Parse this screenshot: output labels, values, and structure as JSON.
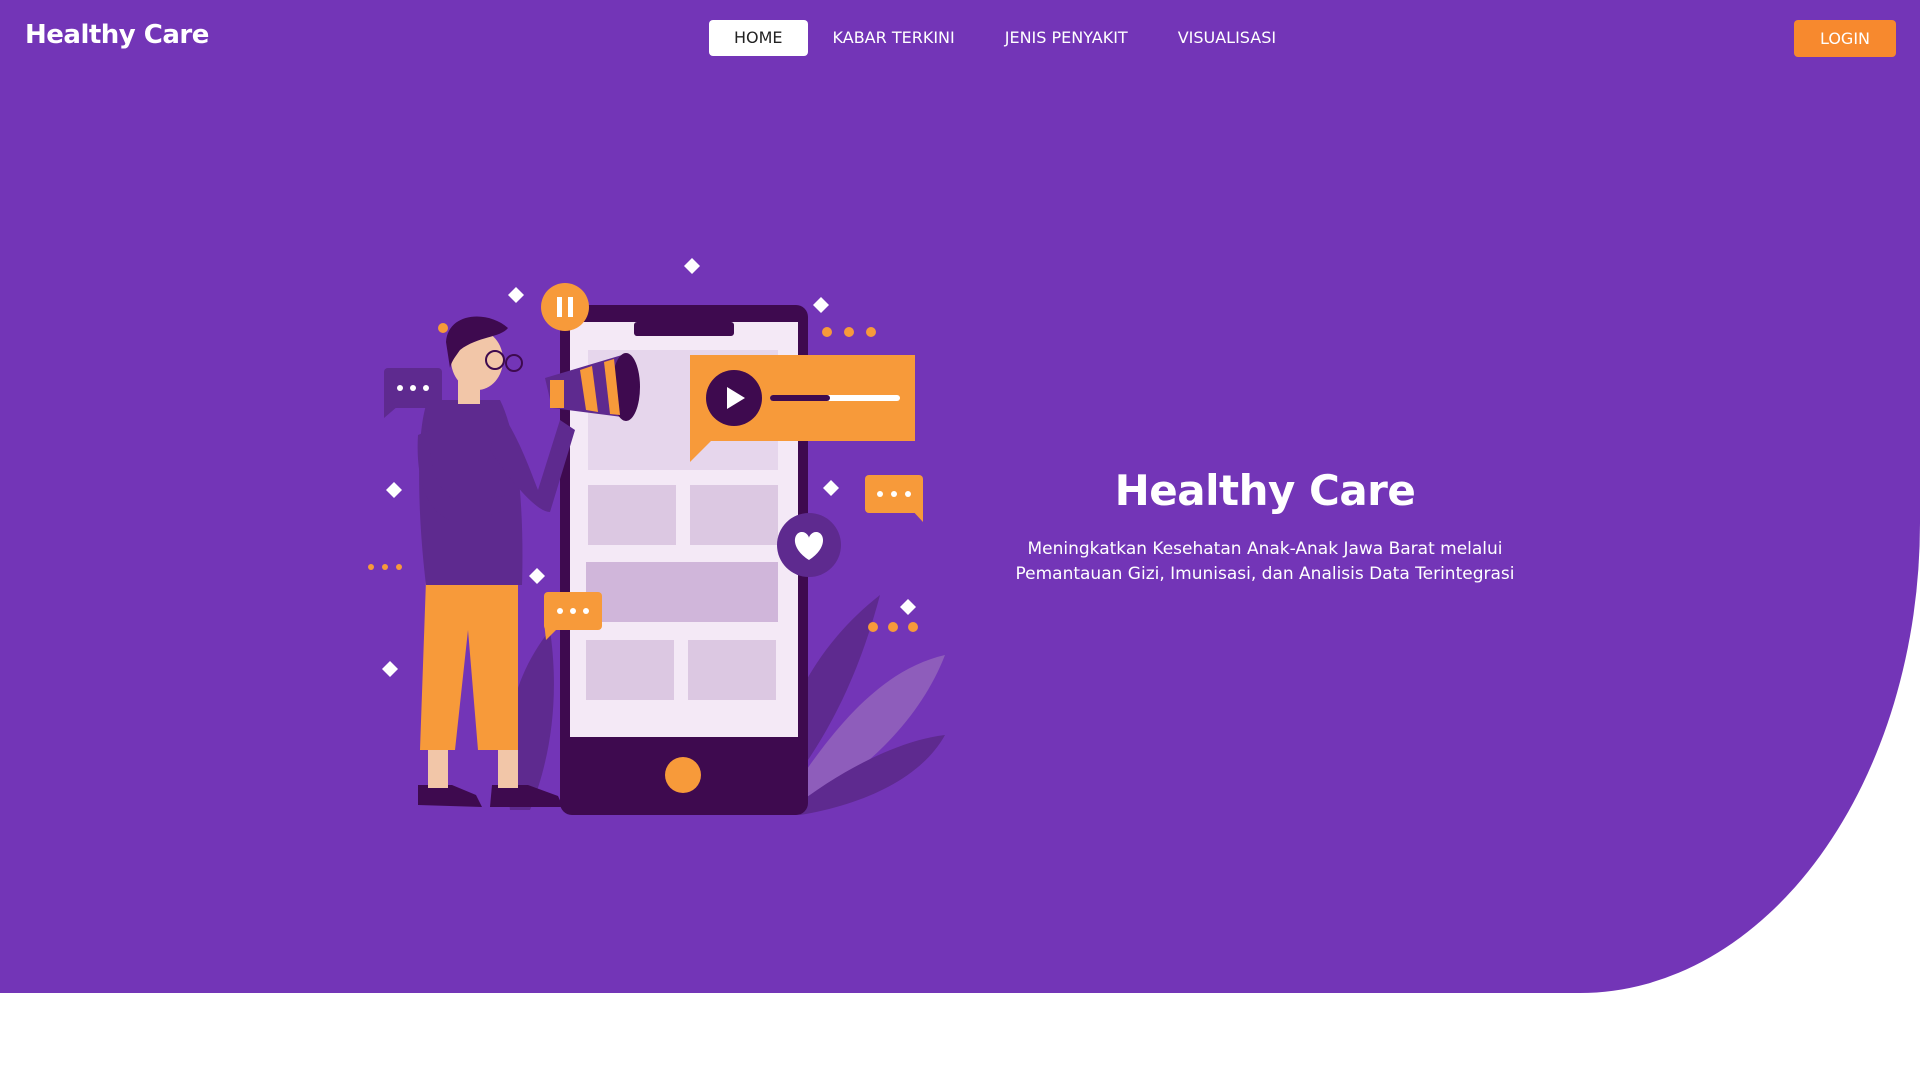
{
  "brand": {
    "name": "Healthy Care"
  },
  "nav": {
    "items": [
      {
        "label": "HOME",
        "active": true
      },
      {
        "label": "KABAR TERKINI",
        "active": false
      },
      {
        "label": "JENIS PENYAKIT",
        "active": false
      },
      {
        "label": "VISUALISASI",
        "active": false
      }
    ],
    "login_label": "LOGIN"
  },
  "hero": {
    "title": "Healthy Care",
    "subtitle_line1": "Meningkatkan Kesehatan Anak-Anak Jawa Barat melalui",
    "subtitle_line2": "Pemantauan Gizi, Imunisasi, dan Analisis Data Terintegrasi"
  },
  "colors": {
    "hero_background": "#7335B7",
    "accent_orange": "#F7892E",
    "phone_dark": "#3E0A4F",
    "page_background": "#FFFFFF"
  },
  "icons": [
    "pause-icon",
    "play-icon",
    "heart-icon",
    "chat-dots-icon",
    "megaphone-icon",
    "sparkle-icon"
  ]
}
